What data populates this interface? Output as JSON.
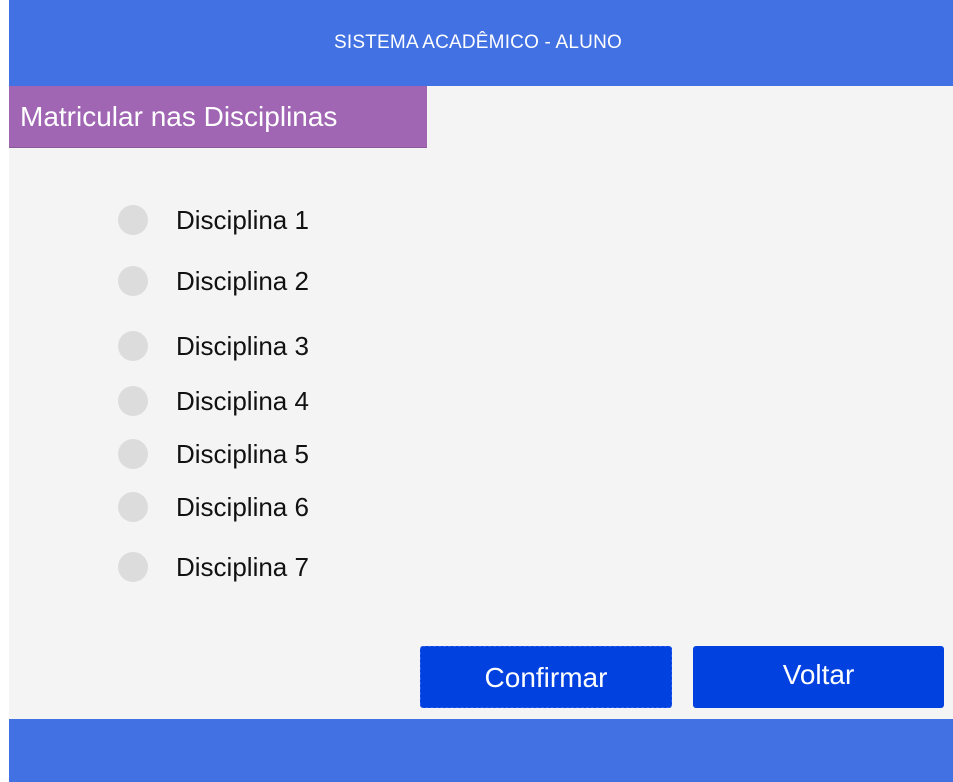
{
  "header": {
    "title": "SISTEMA ACADÊMICO - ALUNO"
  },
  "section": {
    "title": "Matricular nas Disciplinas"
  },
  "disciplines": [
    {
      "label": "Disciplina 1",
      "selected": false
    },
    {
      "label": "Disciplina 2",
      "selected": false
    },
    {
      "label": "Disciplina 3",
      "selected": false
    },
    {
      "label": "Disciplina 4",
      "selected": false
    },
    {
      "label": "Disciplina 5",
      "selected": false
    },
    {
      "label": "Disciplina 6",
      "selected": false
    },
    {
      "label": "Disciplina 7",
      "selected": false
    }
  ],
  "actions": {
    "confirm_label": "Confirmar",
    "back_label": "Voltar"
  },
  "colors": {
    "header_bar": "#4271e3",
    "section_tab": "#a065b3",
    "button": "#0041e0",
    "background": "#f4f4f4",
    "radio_unselected": "#dcdcdc"
  },
  "icons": {
    "radio": "radio-unselected-icon"
  }
}
